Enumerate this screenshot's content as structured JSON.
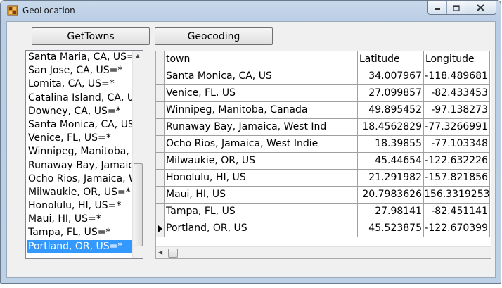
{
  "window": {
    "title": "GeoLocation"
  },
  "toolbar": {
    "gettowns_label": "GetTowns",
    "geocoding_label": "Geocoding"
  },
  "town_list": {
    "items": [
      "Santa Maria, CA, US=*",
      "San Jose, CA, US=*",
      "Lomita, CA, US=*",
      "Catalina Island, CA, US=*",
      "Downey, CA, US=*",
      "Santa Monica, CA, US=*",
      "Venice, FL, US=*",
      "Winnipeg, Manitoba, Canada=*",
      "Runaway Bay, Jamaica, West Indies=*",
      "Ocho Rios, Jamaica, West Indies=*",
      "Milwaukie, OR, US=*",
      "Honolulu, HI, US=*",
      "Maui, HI, US=*",
      "Tampa, FL, US=*",
      "Portland, OR, US=*"
    ],
    "selected": "Portland, OR, US=*"
  },
  "grid": {
    "columns": [
      "town",
      "Latitude",
      "Longitude"
    ],
    "rows": [
      {
        "town": "Santa Monica, CA, US",
        "lat": "34.007967",
        "lon": "-118.489681"
      },
      {
        "town": "Venice, FL, US",
        "lat": "27.099857",
        "lon": "-82.433453"
      },
      {
        "town": "Winnipeg, Manitoba, Canada",
        "lat": "49.895452",
        "lon": "-97.138273"
      },
      {
        "town": "Runaway Bay, Jamaica, West Ind",
        "lat": "18.4562829",
        "lon": "-77.3266991"
      },
      {
        "town": "Ocho Rios, Jamaica, West Indie",
        "lat": "18.39855",
        "lon": "-77.103348"
      },
      {
        "town": "Milwaukie, OR, US",
        "lat": "45.44654",
        "lon": "-122.632226"
      },
      {
        "town": "Honolulu, HI, US",
        "lat": "21.291982",
        "lon": "-157.821856"
      },
      {
        "town": "Maui, HI, US",
        "lat": "20.7983626",
        "lon": "156.3319253"
      },
      {
        "town": "Tampa, FL, US",
        "lat": "27.98141",
        "lon": "-82.451141"
      },
      {
        "town": "Portland, OR, US",
        "lat": "45.523875",
        "lon": "-122.670399"
      }
    ],
    "current_row": 9
  },
  "icons": {
    "app": "globe-app-icon",
    "minimize": "minimize-icon",
    "maximize": "maximize-icon",
    "close": "close-icon"
  },
  "colors": {
    "selection": "#3399ff",
    "titlebar": "#c9d9ec"
  }
}
